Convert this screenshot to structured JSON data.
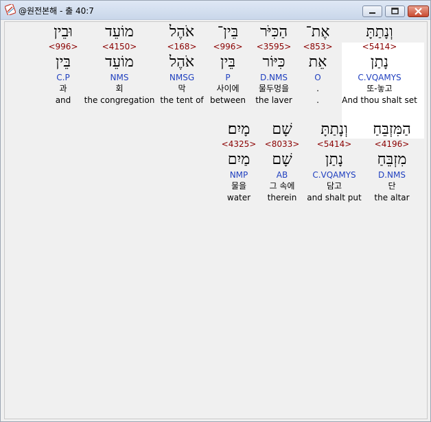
{
  "window": {
    "title": "@원전본해 - 출 40:7",
    "icon": "app-document-icon"
  },
  "colors": {
    "strong_number": "#8b0000",
    "morphology": "#1f3fbf",
    "highlight_bg": "#ffffff"
  },
  "rows": [
    {
      "words": [
        {
          "heb": "וְנָתַתָּ",
          "num": "<5414>",
          "lemma": "נָתַן",
          "morph": "C.VQAMYS",
          "kor": "또-놓고",
          "eng": "And thou shalt set",
          "highlighted": true
        },
        {
          "heb": "אֶת־",
          "num": "<853>",
          "lemma": "אֵת",
          "morph": "O",
          "kor": ".",
          "eng": "."
        },
        {
          "heb": "הַכִּיֹּר",
          "num": "<3595>",
          "lemma": "כִּיּוֹר",
          "morph": "D.NMS",
          "kor": "물두멍을",
          "eng": "the laver"
        },
        {
          "heb": "בֵּין־",
          "num": "<996>",
          "lemma": "בֵּין",
          "morph": "P",
          "kor": "사이에",
          "eng": "between"
        },
        {
          "heb": "אֹהֶל",
          "num": "<168>",
          "lemma": "אֹהֶל",
          "morph": "NMSG",
          "kor": "막",
          "eng": "the tent of"
        },
        {
          "heb": "מוֹעֵד",
          "num": "<4150>",
          "lemma": "מוֹעֵד",
          "morph": "NMS",
          "kor": "회",
          "eng": "the congregation"
        },
        {
          "heb": "וּבֵין",
          "num": "<996>",
          "lemma": "בֵּין",
          "morph": "C.P",
          "kor": "과",
          "eng": "and"
        }
      ]
    },
    {
      "words": [
        {
          "heb": "הַמִּזְבֵּחַ",
          "num": "<4196>",
          "lemma": "מִזְבֵּחַ",
          "morph": "D.NMS",
          "kor": "단",
          "eng": "the altar"
        },
        {
          "heb": "וְנָתַתָּ",
          "num": "<5414>",
          "lemma": "נָתַן",
          "morph": "C.VQAMYS",
          "kor": "담고",
          "eng": "and shalt put"
        },
        {
          "heb": "שָׁם",
          "num": "<8033>",
          "lemma": "שָׁם",
          "morph": "AB",
          "kor": "그 속에",
          "eng": "therein"
        },
        {
          "heb": "מָיִם׃",
          "num": "<4325>",
          "lemma": "מַיִם",
          "morph": "NMP",
          "kor": "물을",
          "eng": "water"
        }
      ]
    }
  ]
}
